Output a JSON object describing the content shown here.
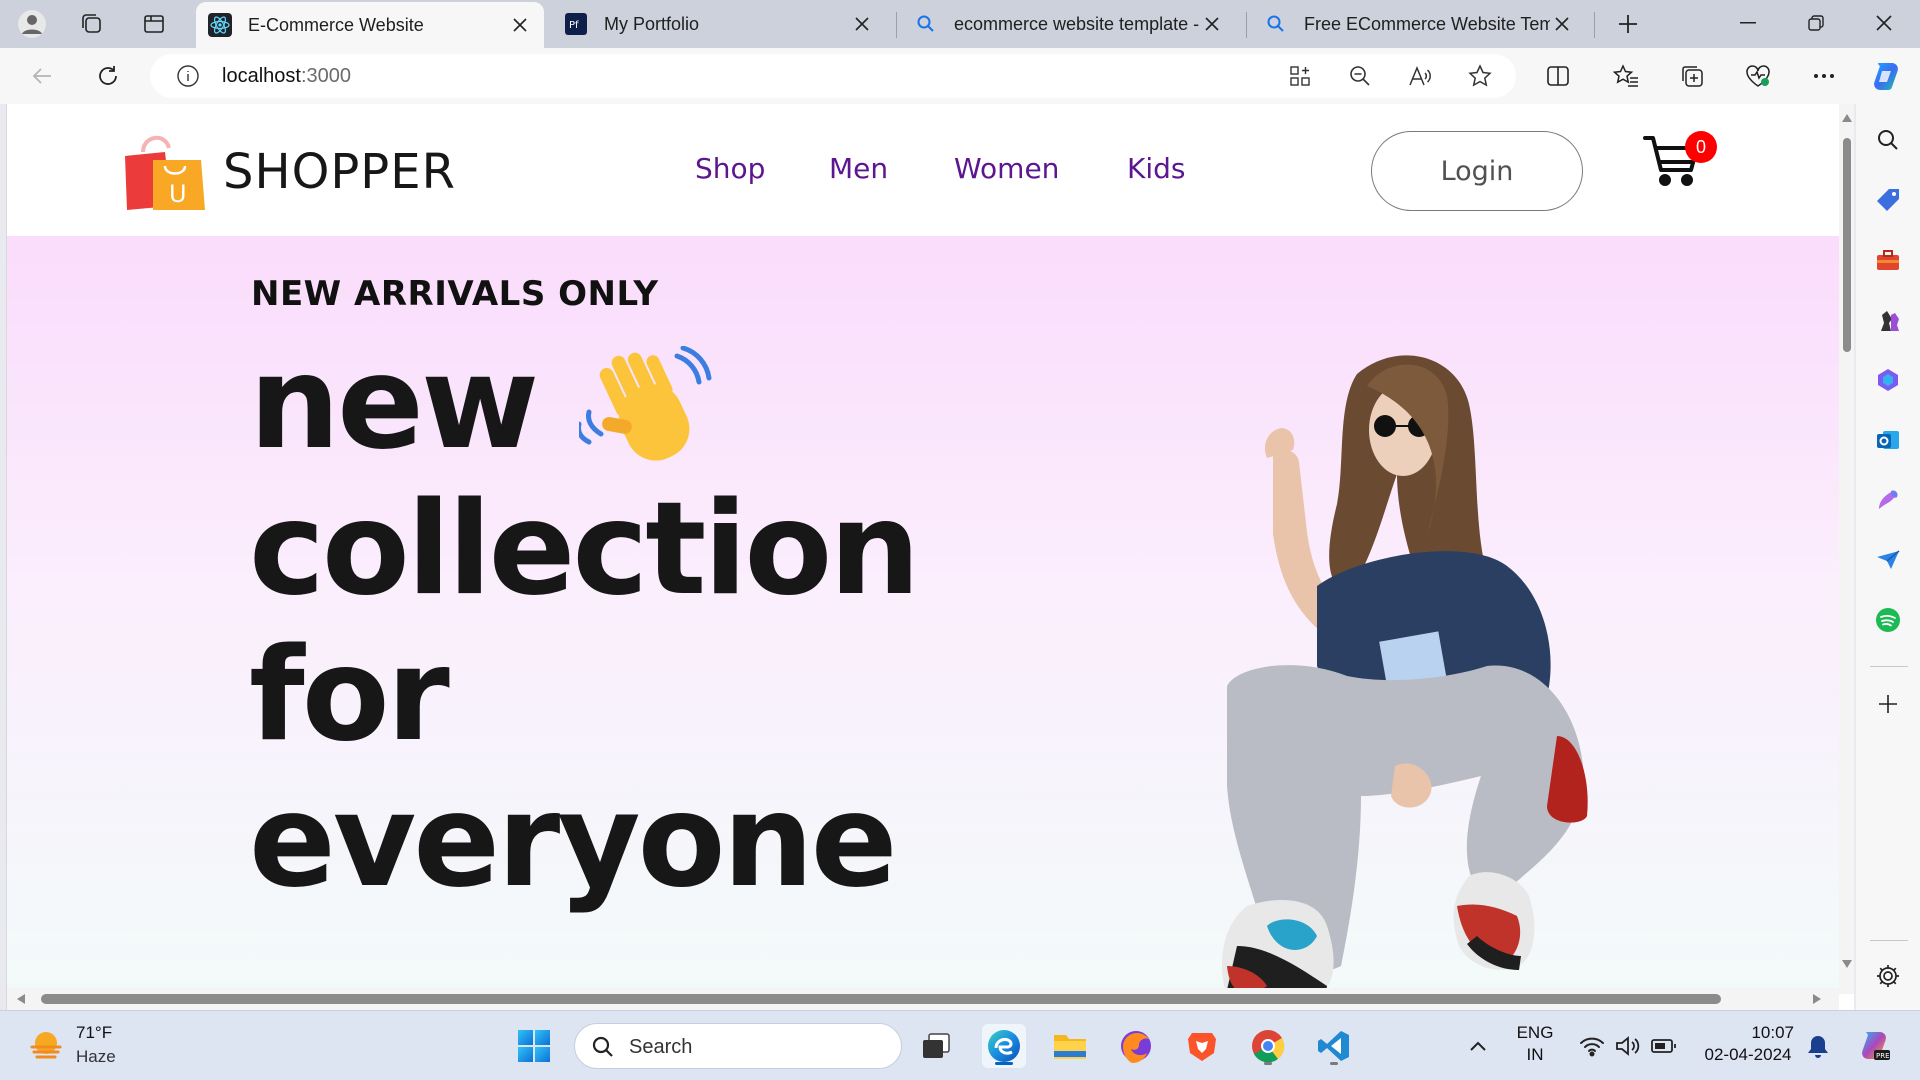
{
  "browser": {
    "tabs": [
      {
        "title": "E-Commerce Website",
        "active": true,
        "favicon": "react-icon"
      },
      {
        "title": "My Portfolio",
        "active": false,
        "favicon": "pf-icon"
      },
      {
        "title": "ecommerce website template -",
        "active": false,
        "favicon": "search-icon"
      },
      {
        "title": "Free ECommerce Website Temp",
        "active": false,
        "favicon": "search-icon"
      }
    ],
    "url_host": "localhost",
    "url_port": ":3000"
  },
  "site": {
    "brand": "SHOPPER",
    "logo_letter": "U",
    "menu": [
      "Shop",
      "Men",
      "Women",
      "Kids"
    ],
    "login_label": "Login",
    "cart_count": "0",
    "accent_color": "#5b1690"
  },
  "hero": {
    "eyebrow": "NEW ARRIVALS ONLY",
    "lines": [
      "new",
      "collection",
      "for",
      "everyone"
    ]
  },
  "taskbar": {
    "temperature": "71°F",
    "condition": "Haze",
    "search_label": "Search",
    "language": "ENG",
    "region": "IN",
    "time": "10:07",
    "date": "02-04-2024"
  }
}
